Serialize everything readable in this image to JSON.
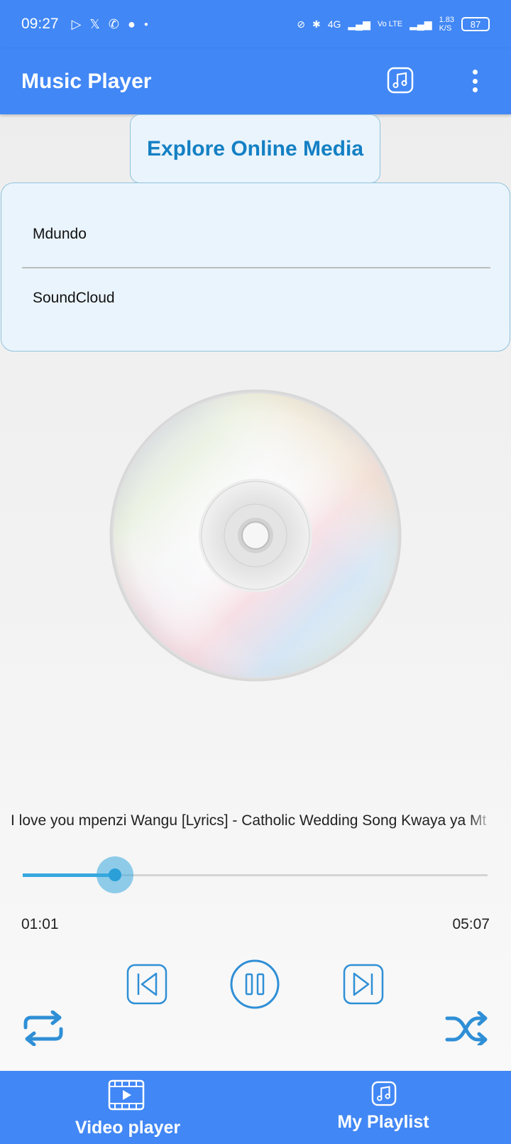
{
  "status_bar": {
    "time": "09:27",
    "network": "4G",
    "volte": "Vo LTE",
    "speed": "1.83",
    "speed_unit": "K/S",
    "battery": "87"
  },
  "app_bar": {
    "title": "Music Player"
  },
  "explore": {
    "label": "Explore Online Media"
  },
  "media_sources": [
    {
      "label": "Mdundo"
    },
    {
      "label": "SoundCloud"
    }
  ],
  "player": {
    "song_title": "I love you mpenzi Wangu [Lyrics] - Catholic Wedding Song Kwaya ya Mt",
    "current_time": "01:01",
    "total_time": "05:07",
    "progress_fraction": 0.199,
    "is_playing": true
  },
  "bottom_nav": {
    "video_label": "Video player",
    "playlist_label": "My Playlist"
  },
  "colors": {
    "primary": "#4187f5",
    "accent": "#1480c4",
    "seek": "#37a8de",
    "panel_bg": "#eaf4fc",
    "panel_border": "#8fc3df"
  }
}
